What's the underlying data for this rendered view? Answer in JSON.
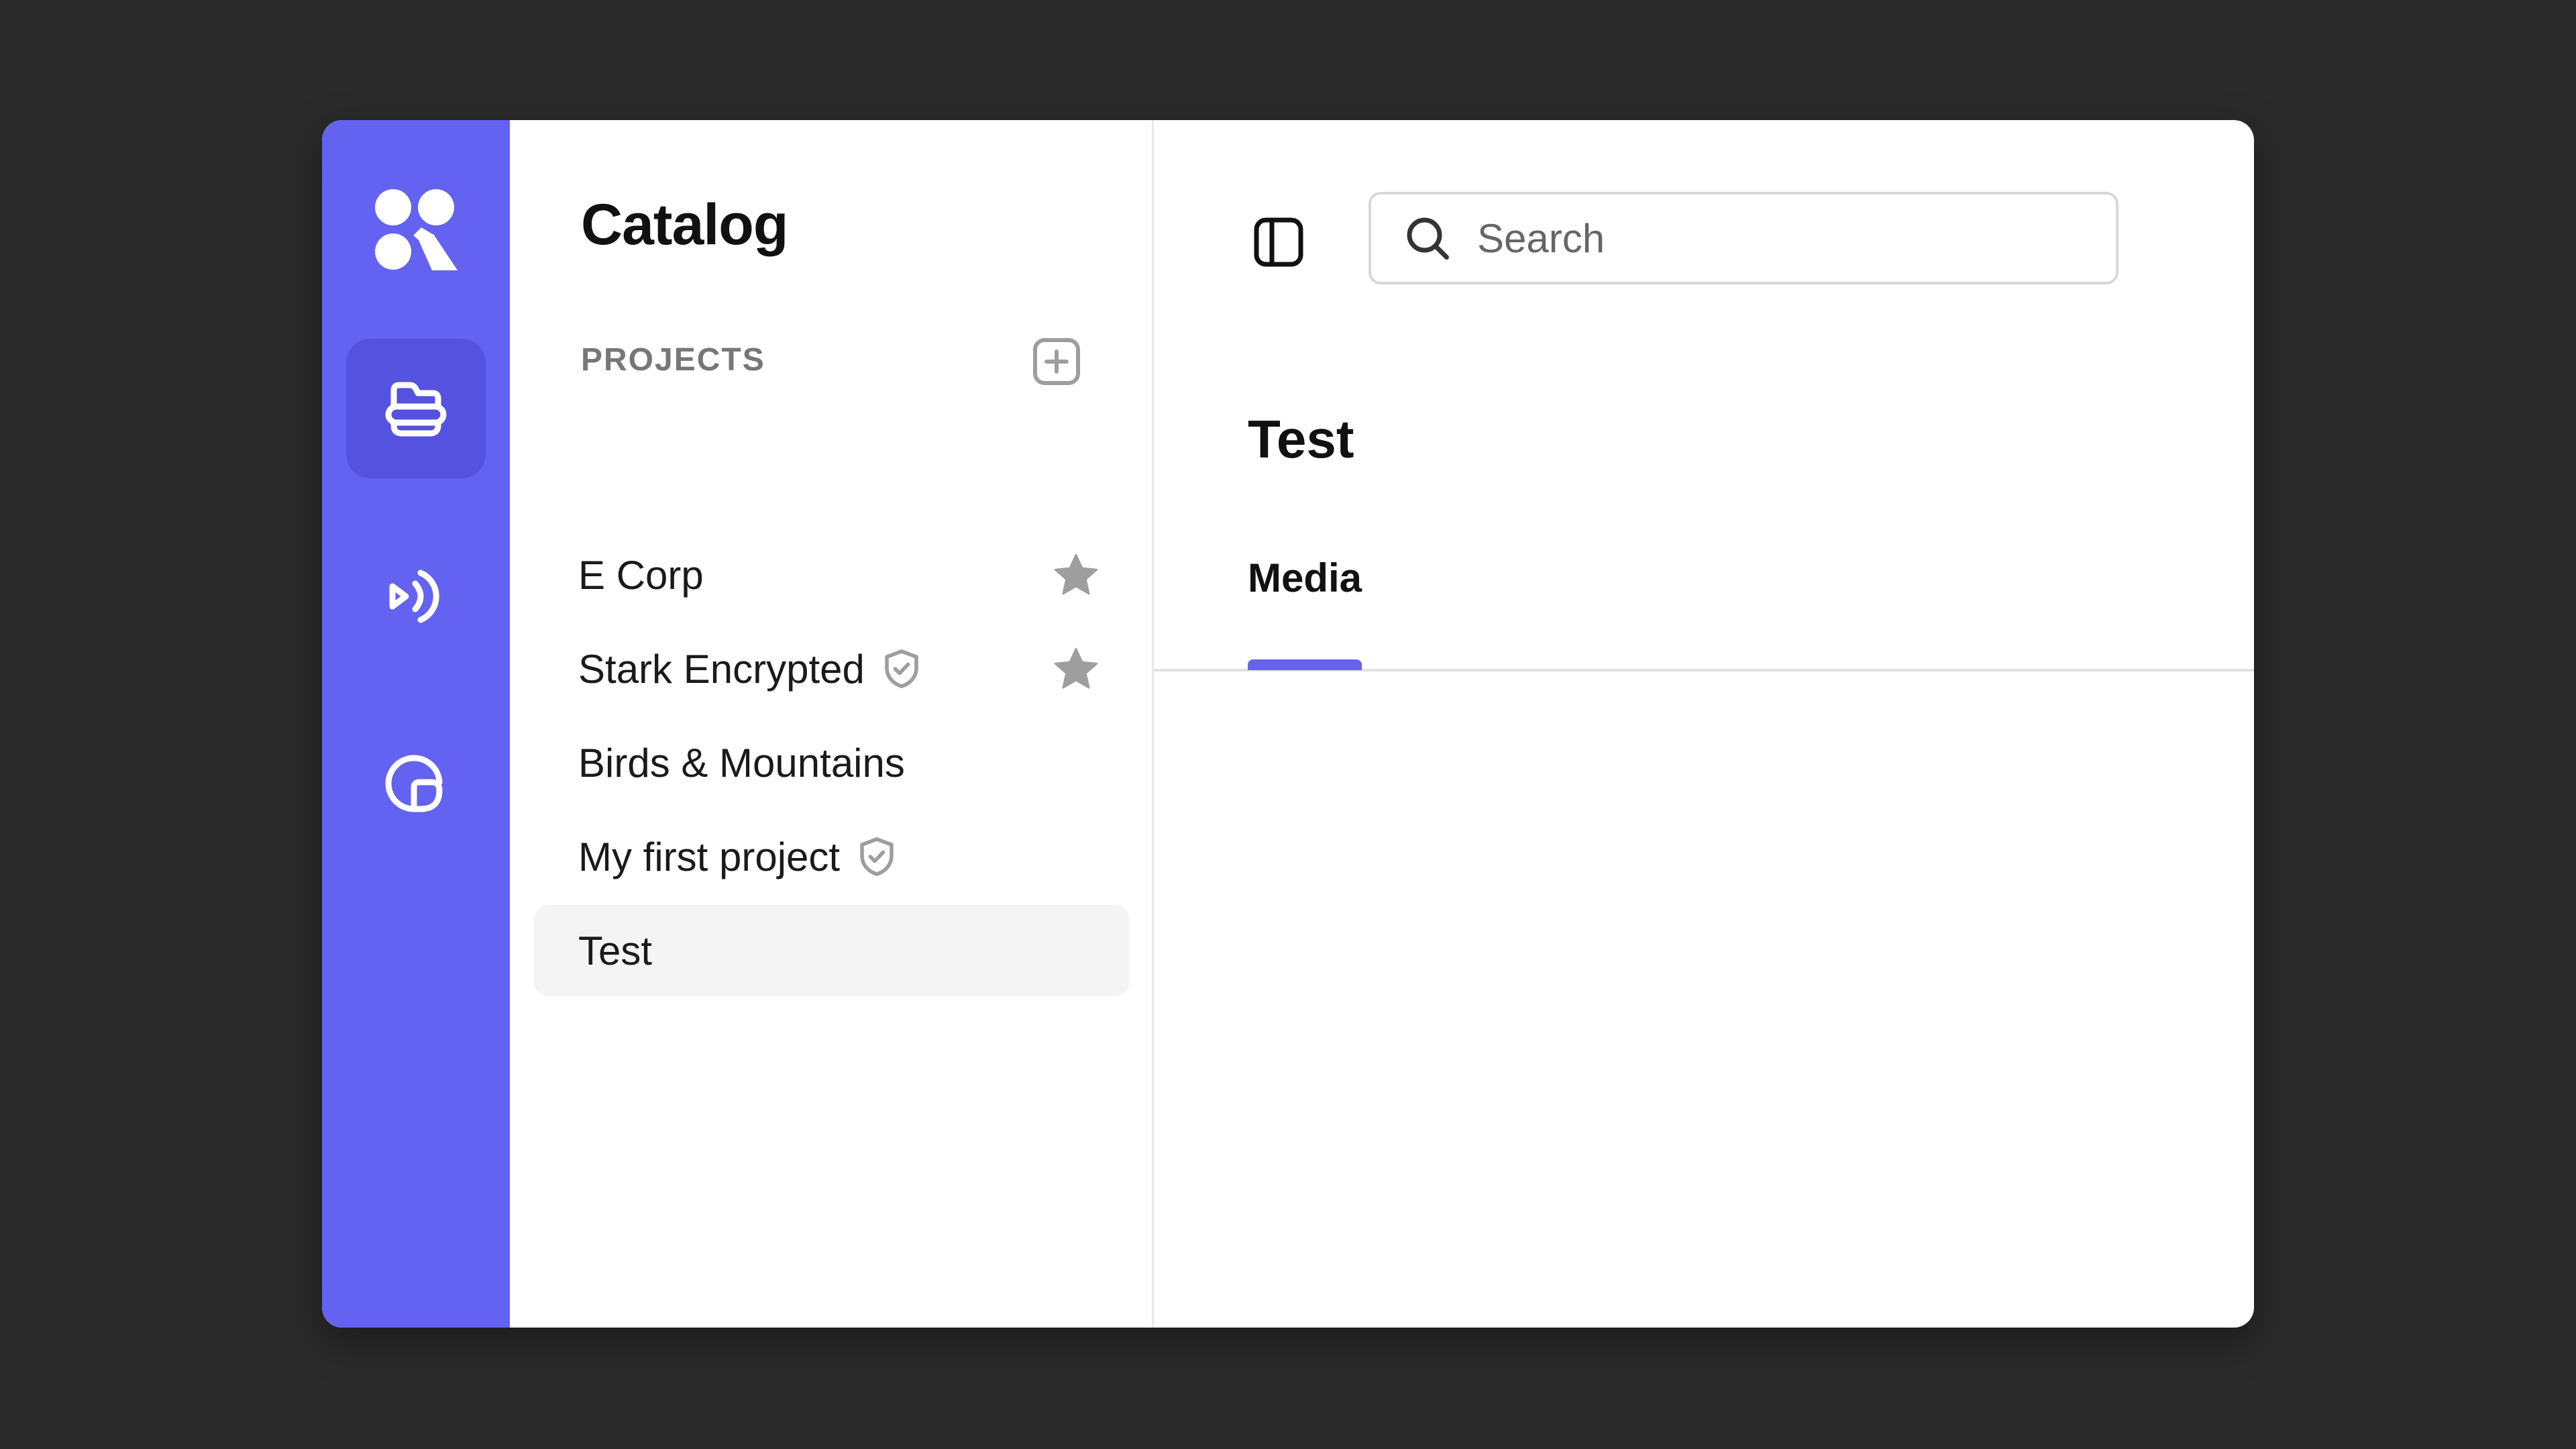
{
  "colors": {
    "accent": "#6462f1",
    "backdrop": "#2a2a2a",
    "icon_gray": "#9e9e9e"
  },
  "rail": {
    "logo_icon": "app-logo",
    "items": [
      {
        "icon": "folder-stack-icon",
        "active": true
      },
      {
        "icon": "broadcast-icon",
        "active": false
      },
      {
        "icon": "pie-chart-icon",
        "active": false
      }
    ]
  },
  "catalog": {
    "title": "Catalog",
    "section_label": "PROJECTS",
    "add_icon": "plus-square-icon",
    "projects": [
      {
        "name": "E Corp",
        "encrypted": false,
        "starred": true,
        "selected": false
      },
      {
        "name": "Stark Encrypted",
        "encrypted": true,
        "starred": true,
        "selected": false
      },
      {
        "name": "Birds & Mountains",
        "encrypted": false,
        "starred": false,
        "selected": false
      },
      {
        "name": "My first project",
        "encrypted": true,
        "starred": false,
        "selected": false
      },
      {
        "name": "Test",
        "encrypted": false,
        "starred": false,
        "selected": true
      }
    ]
  },
  "main": {
    "toggle_icon": "sidebar-toggle-icon",
    "search": {
      "placeholder": "Search",
      "value": ""
    },
    "title": "Test",
    "tabs": [
      {
        "label": "Media",
        "active": true
      }
    ]
  }
}
